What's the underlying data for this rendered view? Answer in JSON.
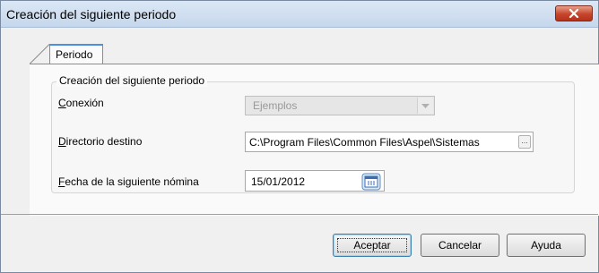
{
  "window": {
    "title": "Creación del siguiente periodo",
    "close_icon": "close-icon"
  },
  "tabs": [
    {
      "label": "Periodo",
      "active": true
    }
  ],
  "group": {
    "legend": "Creación del siguiente periodo",
    "fields": {
      "connection": {
        "label": "Conexión",
        "value": "Ejemplos",
        "enabled": false
      },
      "directory": {
        "label": "Directorio destino",
        "value": "C:\\Program Files\\Common Files\\Aspel\\Sistemas",
        "browse_label": "..."
      },
      "next_date": {
        "label": "Fecha de la siguiente nómina",
        "value": "15/01/2012",
        "calendar_icon": "calendar-icon"
      }
    }
  },
  "buttons": {
    "accept": "Aceptar",
    "cancel": "Cancelar",
    "help": "Ayuda"
  }
}
